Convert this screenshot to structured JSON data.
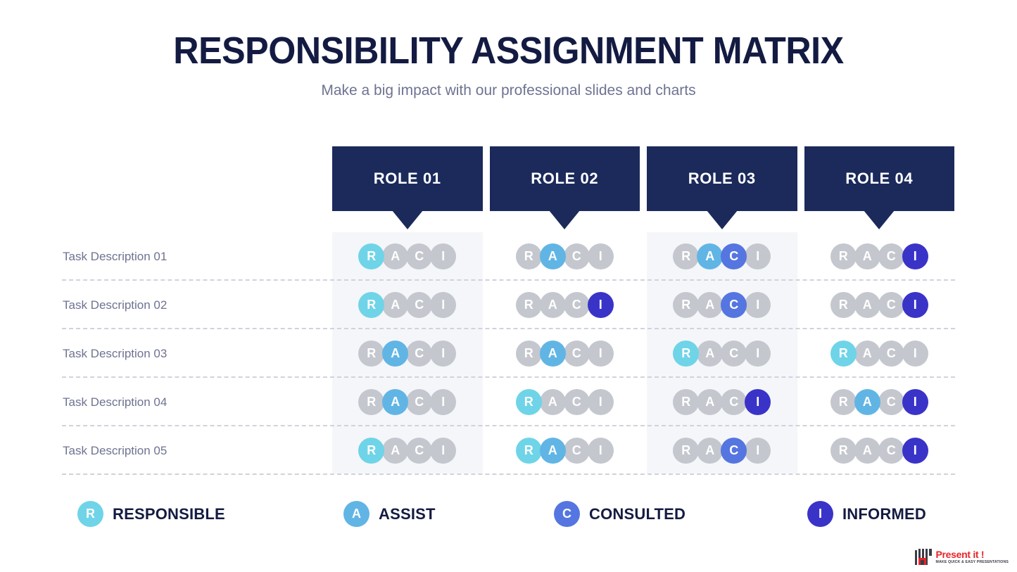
{
  "header": {
    "title": "RESPONSIBILITY ASSIGNMENT MATRIX",
    "subtitle": "Make a big impact with our professional slides and charts"
  },
  "roles": [
    {
      "label": "ROLE 01"
    },
    {
      "label": "ROLE 02"
    },
    {
      "label": "ROLE 03"
    },
    {
      "label": "ROLE 04"
    }
  ],
  "keys": [
    "R",
    "A",
    "C",
    "I"
  ],
  "tasks": [
    {
      "label": "Task Description 01",
      "assignments": [
        [
          "R"
        ],
        [
          "A"
        ],
        [
          "A",
          "C"
        ],
        [
          "I"
        ]
      ]
    },
    {
      "label": "Task Description 02",
      "assignments": [
        [
          "R"
        ],
        [
          "I"
        ],
        [
          "C"
        ],
        [
          "I"
        ]
      ]
    },
    {
      "label": "Task Description 03",
      "assignments": [
        [
          "A"
        ],
        [
          "A"
        ],
        [
          "R"
        ],
        [
          "R"
        ]
      ]
    },
    {
      "label": "Task Description 04",
      "assignments": [
        [
          "A"
        ],
        [
          "R"
        ],
        [
          "I"
        ],
        [
          "A",
          "I"
        ]
      ]
    },
    {
      "label": "Task Description 05",
      "assignments": [
        [
          "R"
        ],
        [
          "R",
          "A"
        ],
        [
          "C"
        ],
        [
          "I"
        ]
      ]
    }
  ],
  "legend": [
    {
      "key": "R",
      "label": "RESPONSIBLE",
      "color": "#6FD4E8"
    },
    {
      "key": "A",
      "label": "ASSIST",
      "color": "#61B5E5"
    },
    {
      "key": "C",
      "label": "CONSULTED",
      "color": "#5576E0"
    },
    {
      "key": "I",
      "label": "INFORMED",
      "color": "#3A33C8"
    }
  ],
  "colors": {
    "navy": "#1B2A5B",
    "title": "#141B42",
    "muted": "#6E7391",
    "inactive": "#C4C7CE",
    "band": "#F4F6F9",
    "logo_red": "#E8242A"
  },
  "logo": {
    "name": "Present it !",
    "tagline": "MAKE QUICK & EASY PRESENTATIONS"
  }
}
